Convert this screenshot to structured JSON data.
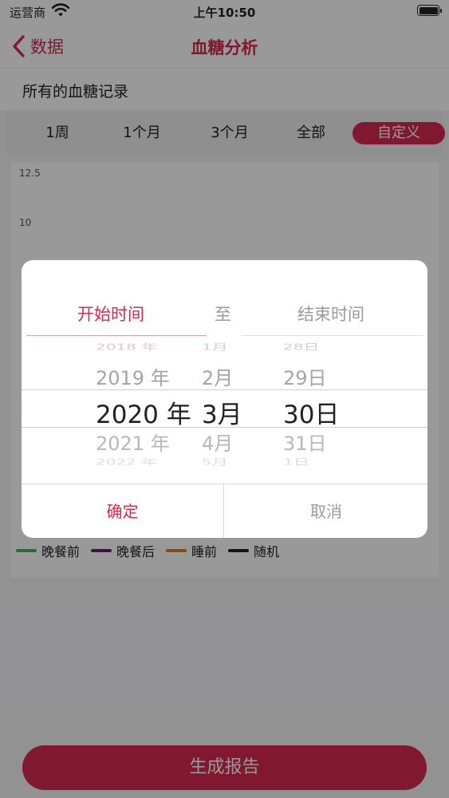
{
  "status_bar": {
    "carrier": "运营商",
    "time": "上午10:50"
  },
  "nav": {
    "back_label": "数据",
    "title": "血糖分析"
  },
  "section_title": "所有的血糖记录",
  "range_tabs": [
    "1周",
    "1个月",
    "3个月",
    "全部",
    "自定义"
  ],
  "range_selected": "自定义",
  "chart": {
    "y_ticks": [
      "12.5",
      "10"
    ]
  },
  "legend": [
    {
      "label": "晚餐前",
      "color": "#4caf50"
    },
    {
      "label": "晚餐后",
      "color": "#6a1b6e"
    },
    {
      "label": "睡前",
      "color": "#e07b1a"
    },
    {
      "label": "随机",
      "color": "#222222"
    }
  ],
  "report_button": "生成报告",
  "date_modal": {
    "tab_start": "开始时间",
    "separator": "至",
    "tab_end": "结束时间",
    "years": [
      "2018 年",
      "2019 年",
      "2020 年",
      "2021 年",
      "2022 年"
    ],
    "months": [
      "1月",
      "2月",
      "3月",
      "4月",
      "5月"
    ],
    "days": [
      "28日",
      "29日",
      "30日",
      "31日",
      "1日"
    ],
    "confirm": "确定",
    "cancel": "取消"
  },
  "colors": {
    "accent": "#d6284f"
  }
}
